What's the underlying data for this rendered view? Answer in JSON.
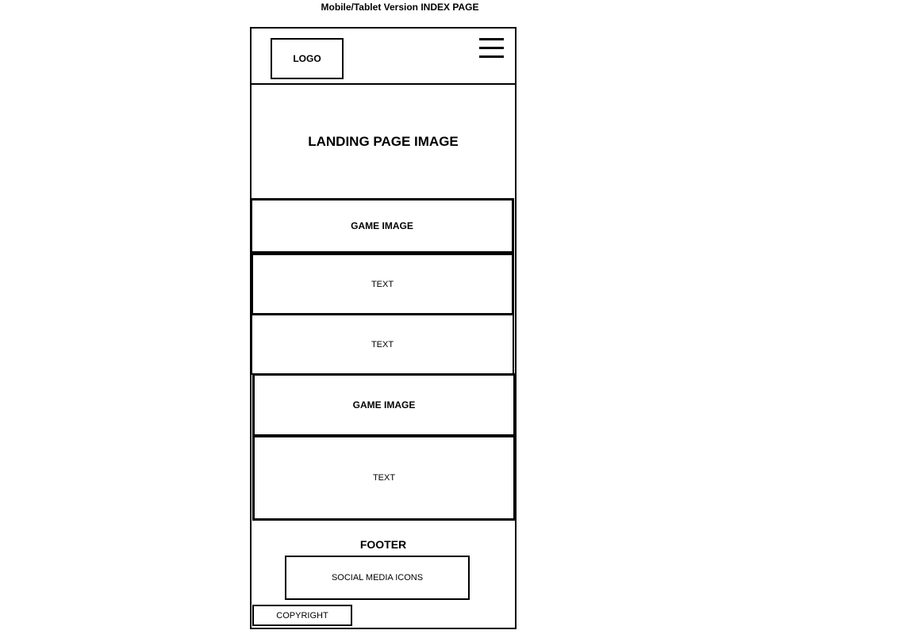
{
  "title": "Mobile/Tablet Version INDEX PAGE",
  "header": {
    "logo_label": "LOGO",
    "menu_icon": "hamburger-menu-icon"
  },
  "landing": {
    "label": "LANDING PAGE IMAGE"
  },
  "sections": {
    "game_image_1": "GAME IMAGE",
    "text_1": "TEXT",
    "text_2": "TEXT",
    "game_image_2": "GAME IMAGE",
    "text_3": "TEXT"
  },
  "footer": {
    "label": "FOOTER",
    "social_label": "SOCIAL MEDIA ICONS",
    "copyright_label": "COPYRIGHT"
  }
}
